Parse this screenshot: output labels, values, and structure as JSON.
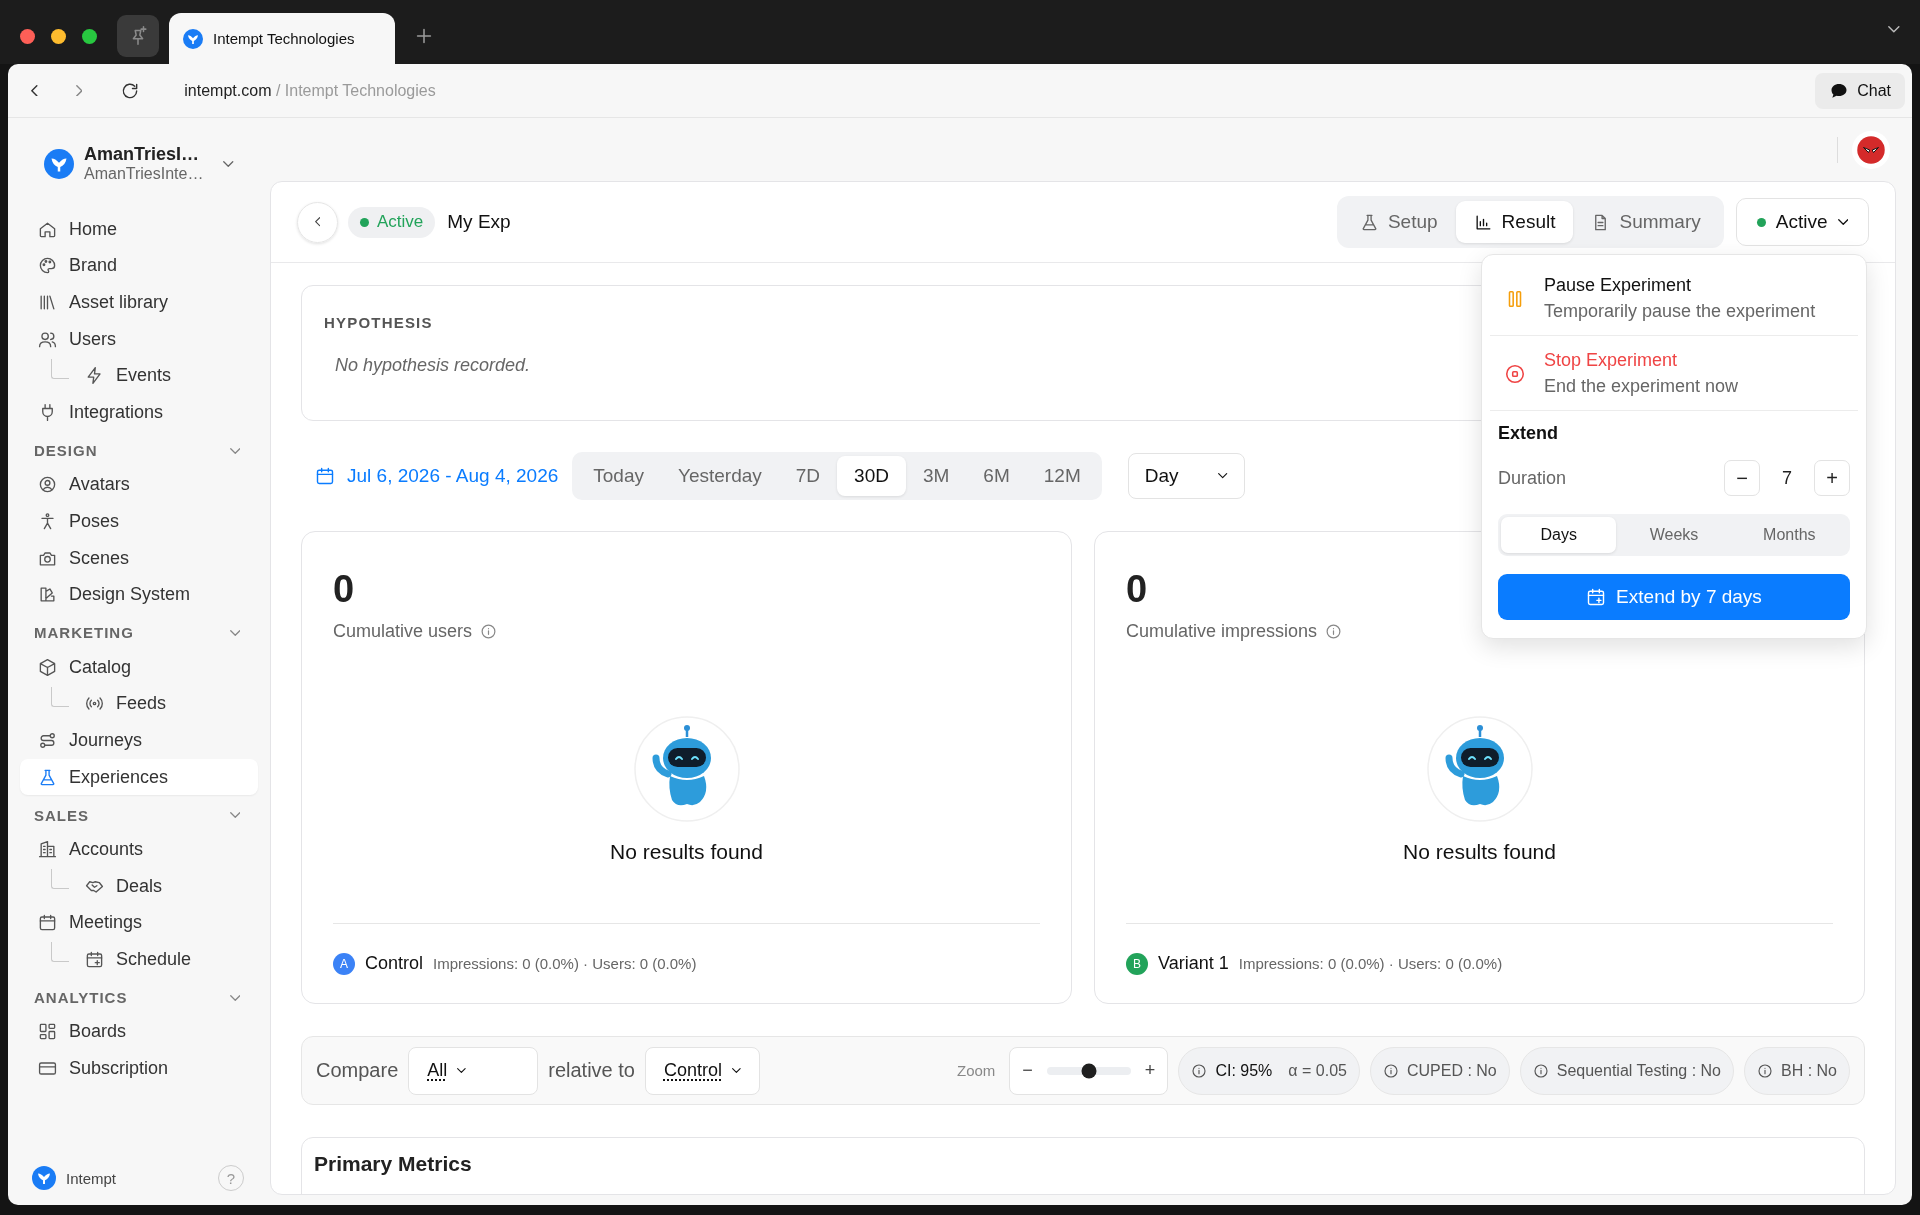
{
  "browser": {
    "tab_title": "Intempt Technologies",
    "url_domain": "intempt.com",
    "url_path": "/ Intempt Technologies",
    "chat_button": "Chat"
  },
  "sidebar": {
    "workspace": {
      "name": "AmanTriesI…",
      "subtitle": "AmanTriesInte…"
    },
    "groups": [
      {
        "items": [
          {
            "label": "Home",
            "selected": false
          },
          {
            "label": "Brand",
            "selected": false
          },
          {
            "label": "Asset library",
            "selected": false
          },
          {
            "label": "Users",
            "selected": false,
            "children": [
              {
                "label": "Events",
                "selected": false
              }
            ]
          },
          {
            "label": "Integrations",
            "selected": false
          }
        ]
      },
      {
        "title": "DESIGN",
        "expanded": true,
        "items": [
          {
            "label": "Avatars",
            "selected": false
          },
          {
            "label": "Poses",
            "selected": false
          },
          {
            "label": "Scenes",
            "selected": false
          },
          {
            "label": "Design System",
            "selected": false
          }
        ]
      },
      {
        "title": "MARKETING",
        "expanded": true,
        "items": [
          {
            "label": "Catalog",
            "selected": false,
            "children": [
              {
                "label": "Feeds",
                "selected": false
              }
            ]
          },
          {
            "label": "Journeys",
            "selected": false
          },
          {
            "label": "Experiences",
            "selected": true
          }
        ]
      },
      {
        "title": "SALES",
        "expanded": true,
        "items": [
          {
            "label": "Accounts",
            "selected": false,
            "children": [
              {
                "label": "Deals",
                "selected": false
              }
            ]
          },
          {
            "label": "Meetings",
            "selected": false,
            "children": [
              {
                "label": "Schedule",
                "selected": false
              }
            ]
          }
        ]
      },
      {
        "title": "ANALYTICS",
        "expanded": true,
        "items": [
          {
            "label": "Boards",
            "selected": false
          },
          {
            "label": "Subscription",
            "selected": false
          }
        ]
      }
    ],
    "footer": {
      "label": "Intempt",
      "help": "?"
    }
  },
  "experiment": {
    "status": "Active",
    "title": "My Exp",
    "view_tabs": [
      {
        "label": "Setup",
        "selected": false
      },
      {
        "label": "Result",
        "selected": true
      },
      {
        "label": "Summary",
        "selected": false
      }
    ],
    "status_button": "Active"
  },
  "status_menu": {
    "actions": [
      {
        "kind": "pause",
        "title": "Pause Experiment",
        "description": "Temporarily pause the experiment"
      },
      {
        "kind": "stop",
        "title": "Stop Experiment",
        "description": "End the experiment now"
      }
    ],
    "extend": {
      "title": "Extend",
      "duration_label": "Duration",
      "decrement": "−",
      "value": "7",
      "increment": "+",
      "units": [
        {
          "label": "Days",
          "selected": true
        },
        {
          "label": "Weeks",
          "selected": false
        },
        {
          "label": "Months",
          "selected": false
        }
      ],
      "button": "Extend by 7 days"
    }
  },
  "hypothesis": {
    "title": "HYPOTHESIS",
    "text": "No hypothesis recorded."
  },
  "date_filter": {
    "range": "Jul 6, 2026 - Aug 4, 2026",
    "presets": [
      {
        "label": "Today",
        "selected": false
      },
      {
        "label": "Yesterday",
        "selected": false
      },
      {
        "label": "7D",
        "selected": false
      },
      {
        "label": "30D",
        "selected": true
      },
      {
        "label": "3M",
        "selected": false
      },
      {
        "label": "6M",
        "selected": false
      },
      {
        "label": "12M",
        "selected": false
      }
    ],
    "granularity": "Day"
  },
  "metric_cards": [
    {
      "value": "0",
      "label": "Cumulative users",
      "empty_text": "No results found",
      "variant": {
        "badge": "A",
        "name": "Control",
        "color": "#3b82f6",
        "stats": "Impressions: 0 (0.0%) · Users: 0 (0.0%)"
      }
    },
    {
      "value": "0",
      "label": "Cumulative impressions",
      "empty_text": "No results found",
      "variant": {
        "badge": "B",
        "name": "Variant 1",
        "color": "#22a35a",
        "stats": "Impressions: 0 (0.0%) · Users: 0 (0.0%)"
      }
    }
  ],
  "comparison": {
    "compare_label": "Compare",
    "compare_value": "All",
    "relative_label": "relative to",
    "relative_value": "Control",
    "zoom": {
      "label": "Zoom",
      "decrement": "−",
      "increment": "+",
      "level": 0.5
    },
    "settings": [
      {
        "label": "CI: 95%",
        "detail": "α = 0.05"
      },
      {
        "label": "CUPED : No"
      },
      {
        "label": "Sequential Testing : No"
      },
      {
        "label": "BH : No"
      }
    ]
  },
  "primary_metrics": {
    "title": "Primary Metrics"
  }
}
